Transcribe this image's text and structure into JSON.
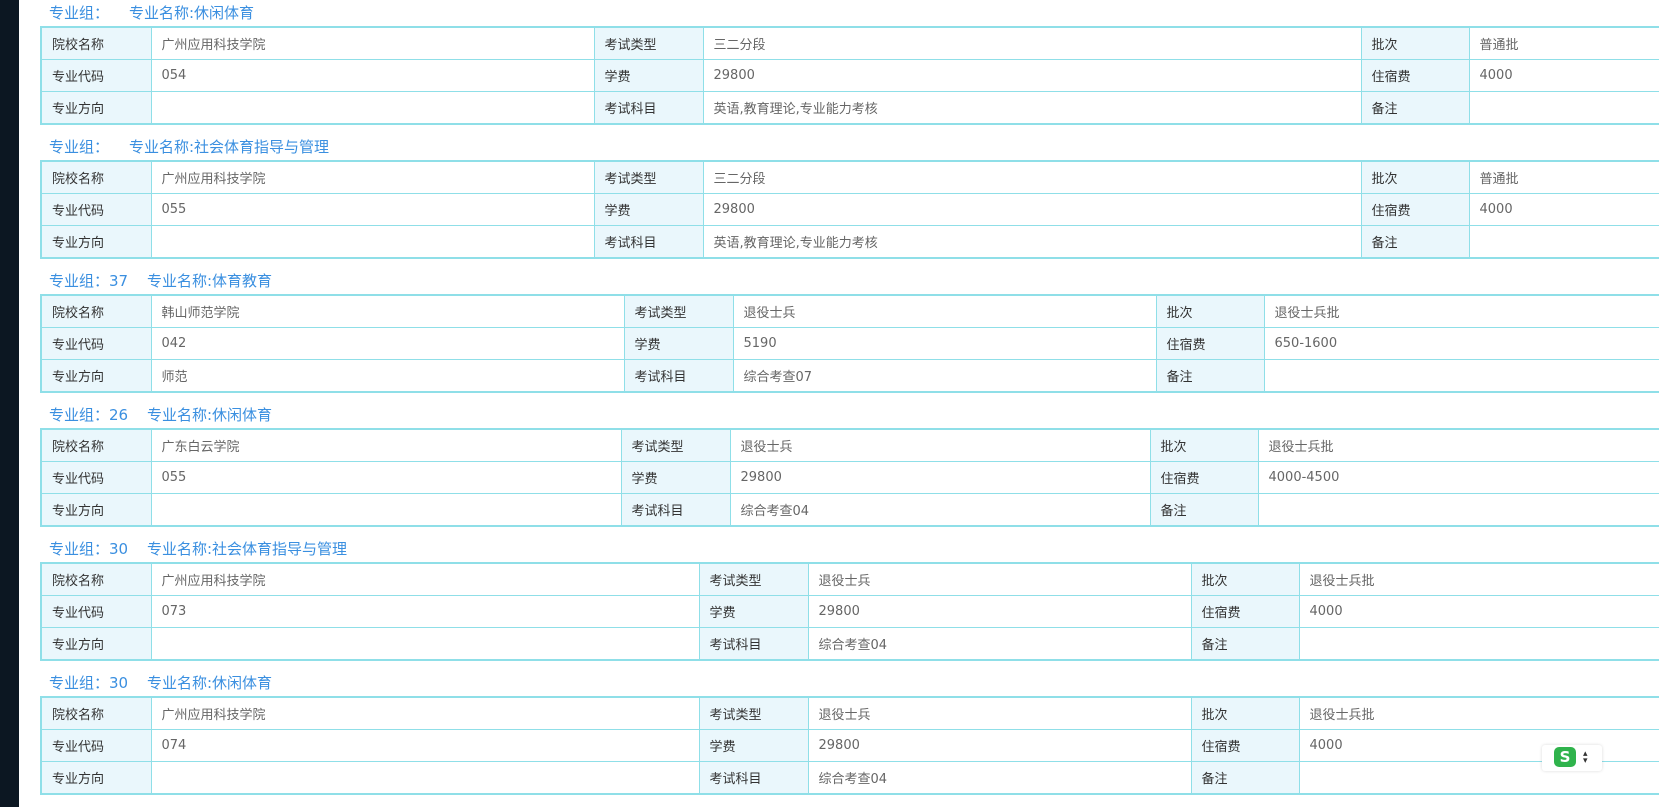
{
  "labels": {
    "school": "院校名称",
    "exam_type": "考试类型",
    "batch": "批次",
    "major_code": "专业代码",
    "tuition": "学费",
    "lodging": "住宿费",
    "direction": "专业方向",
    "exam_subjects": "考试科目",
    "remark": "备注"
  },
  "groups": [
    {
      "group_label": "专业组：",
      "major_label": "专业名称:休闲体育",
      "school": "广州应用科技学院",
      "exam_type": "三二分段",
      "batch": "普通批",
      "major_code": "054",
      "tuition": "29800",
      "lodging": "4000",
      "direction": "",
      "exam_subjects": "英语,教育理论,专业能力考核",
      "remark": ""
    },
    {
      "group_label": "专业组：",
      "major_label": "专业名称:社会体育指导与管理",
      "school": "广州应用科技学院",
      "exam_type": "三二分段",
      "batch": "普通批",
      "major_code": "055",
      "tuition": "29800",
      "lodging": "4000",
      "direction": "",
      "exam_subjects": "英语,教育理论,专业能力考核",
      "remark": ""
    },
    {
      "group_label": "专业组：37",
      "major_label": "专业名称:体育教育",
      "school": "韩山师范学院",
      "exam_type": "退役士兵",
      "batch": "退役士兵批",
      "major_code": "042",
      "tuition": "5190",
      "lodging": "650-1600",
      "direction": "师范",
      "exam_subjects": "综合考查07",
      "remark": ""
    },
    {
      "group_label": "专业组：26",
      "major_label": "专业名称:休闲体育",
      "school": "广东白云学院",
      "exam_type": "退役士兵",
      "batch": "退役士兵批",
      "major_code": "055",
      "tuition": "29800",
      "lodging": "4000-4500",
      "direction": "",
      "exam_subjects": "综合考查04",
      "remark": ""
    },
    {
      "group_label": "专业组：30",
      "major_label": "专业名称:社会体育指导与管理",
      "school": "广州应用科技学院",
      "exam_type": "退役士兵",
      "batch": "退役士兵批",
      "major_code": "073",
      "tuition": "29800",
      "lodging": "4000",
      "direction": "",
      "exam_subjects": "综合考查04",
      "remark": ""
    },
    {
      "group_label": "专业组：30",
      "major_label": "专业名称:休闲体育",
      "school": "广州应用科技学院",
      "exam_type": "退役士兵",
      "batch": "退役士兵批",
      "major_code": "074",
      "tuition": "29800",
      "lodging": "4000",
      "direction": "",
      "exam_subjects": "综合考查04",
      "remark": ""
    }
  ],
  "widget": {
    "logo_text": "S",
    "icon": "sogou-ime-icon",
    "arrow": "expand-arrow-icon"
  },
  "colors": {
    "title": "#3a8fe0",
    "border": "#8fdfe8",
    "label_bg": "#eaf7fc",
    "sidebar": "#0c1722"
  }
}
